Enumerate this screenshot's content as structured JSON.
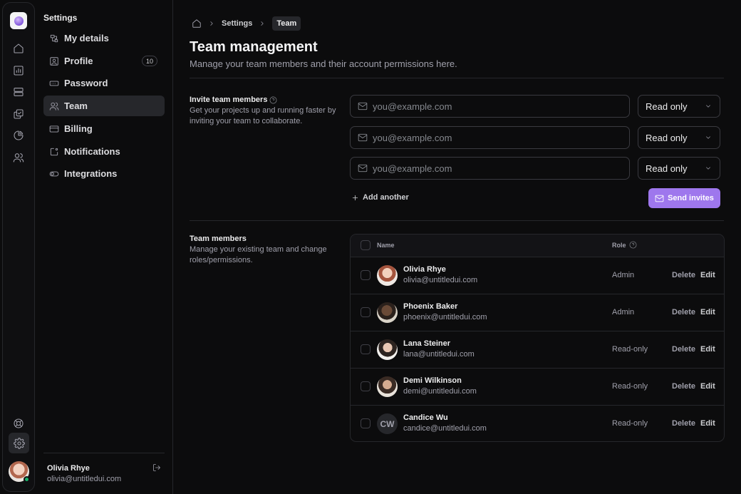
{
  "sidebar": {
    "title": "Settings",
    "items": [
      {
        "label": "My details",
        "icon": "layers-icon"
      },
      {
        "label": "Profile",
        "icon": "user-square-icon",
        "badge": "10"
      },
      {
        "label": "Password",
        "icon": "password-icon"
      },
      {
        "label": "Team",
        "icon": "users-icon",
        "active": true
      },
      {
        "label": "Billing",
        "icon": "credit-card-icon"
      },
      {
        "label": "Notifications",
        "icon": "notification-box-icon"
      },
      {
        "label": "Integrations",
        "icon": "toggle-icon"
      }
    ],
    "user": {
      "name": "Olivia Rhye",
      "email": "olivia@untitledui.com"
    }
  },
  "rail": {
    "icons": [
      "home-icon",
      "bar-chart-icon",
      "rows-icon",
      "copy-check-icon",
      "pie-chart-icon",
      "users-icon",
      "life-buoy-icon",
      "settings-icon"
    ],
    "status_color": "#17b26a"
  },
  "breadcrumb": {
    "items": [
      "Settings",
      "Team"
    ]
  },
  "page": {
    "title": "Team management",
    "subtitle": "Manage your team members and their account permissions here."
  },
  "invite": {
    "title": "Invite team members",
    "description": "Get your projects up and running faster by inviting your team to collaborate.",
    "rows": [
      {
        "placeholder": "you@example.com",
        "role": "Read only"
      },
      {
        "placeholder": "you@example.com",
        "role": "Read only"
      },
      {
        "placeholder": "you@example.com",
        "role": "Read only"
      }
    ],
    "add_label": "Add another",
    "send_label": "Send invites",
    "accent": "#9e77ed"
  },
  "members": {
    "title": "Team members",
    "description": "Manage your existing team and change roles/permissions.",
    "columns": {
      "name": "Name",
      "role": "Role"
    },
    "delete_label": "Delete",
    "edit_label": "Edit",
    "rows": [
      {
        "name": "Olivia Rhye",
        "email": "olivia@untitledui.com",
        "role": "Admin"
      },
      {
        "name": "Phoenix Baker",
        "email": "phoenix@untitledui.com",
        "role": "Admin"
      },
      {
        "name": "Lana Steiner",
        "email": "lana@untitledui.com",
        "role": "Read-only"
      },
      {
        "name": "Demi Wilkinson",
        "email": "demi@untitledui.com",
        "role": "Read-only"
      },
      {
        "name": "Candice Wu",
        "email": "candice@untitledui.com",
        "role": "Read-only",
        "initials": "CW"
      }
    ]
  }
}
